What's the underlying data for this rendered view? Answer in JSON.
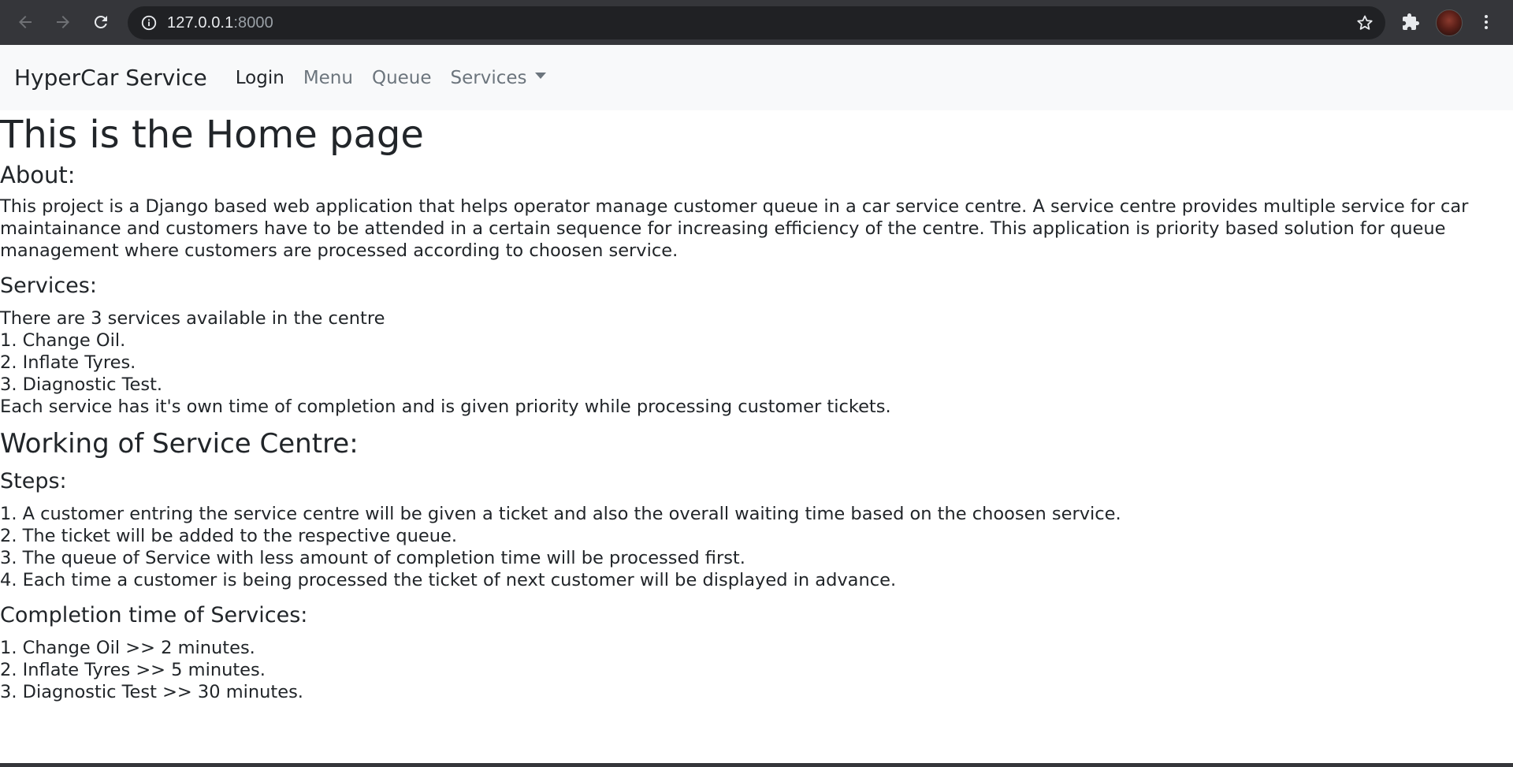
{
  "browser": {
    "url_host": "127.0.0.1",
    "url_port": ":8000",
    "icons": {
      "back": "arrow-left-icon",
      "forward": "arrow-right-icon",
      "reload": "reload-icon",
      "site_info": "info-icon",
      "bookmark": "star-icon",
      "extensions": "puzzle-icon",
      "menu": "kebab-menu-icon"
    }
  },
  "navbar": {
    "brand": "HyperCar Service",
    "links": [
      "Login",
      "Menu",
      "Queue",
      "Services"
    ]
  },
  "page": {
    "title": "This is the Home page",
    "about_heading": "About:",
    "about_text": "This project is a Django based web application that helps operator manage customer queue in a car service centre. A service centre provides multiple service for car maintainance and customers have to be attended in a certain sequence for increasing efficiency of the centre. This application is priority based solution for queue management where customers are processed according to choosen service.",
    "services_heading": "Services:",
    "services_lines": [
      "There are 3 services available in the centre",
      "1. Change Oil.",
      "2. Inflate Tyres.",
      "3. Diagnostic Test.",
      "Each service has it's own time of completion and is given priority while processing customer tickets."
    ],
    "working_heading": "Working of Service Centre:",
    "steps_heading": "Steps:",
    "steps_lines": [
      "1. A customer entring the service centre will be given a ticket and also the overall waiting time based on the choosen service.",
      "2. The ticket will be added to the respective queue.",
      "3. The queue of Service with less amount of completion time will be processed first.",
      "4. Each time a customer is being processed the ticket of next customer will be displayed in advance."
    ],
    "completion_heading": "Completion time of Services:",
    "completion_lines": [
      "1. Change Oil >> 2 minutes.",
      "2. Inflate Tyres >> 5 minutes.",
      "3. Diagnostic Test >> 30 minutes."
    ]
  },
  "colors": {
    "chrome_bg": "#35363a",
    "omnibox_bg": "#202124",
    "navbar_bg": "#f8f9fa",
    "text": "#212529",
    "nav_muted": "#6c757d"
  }
}
